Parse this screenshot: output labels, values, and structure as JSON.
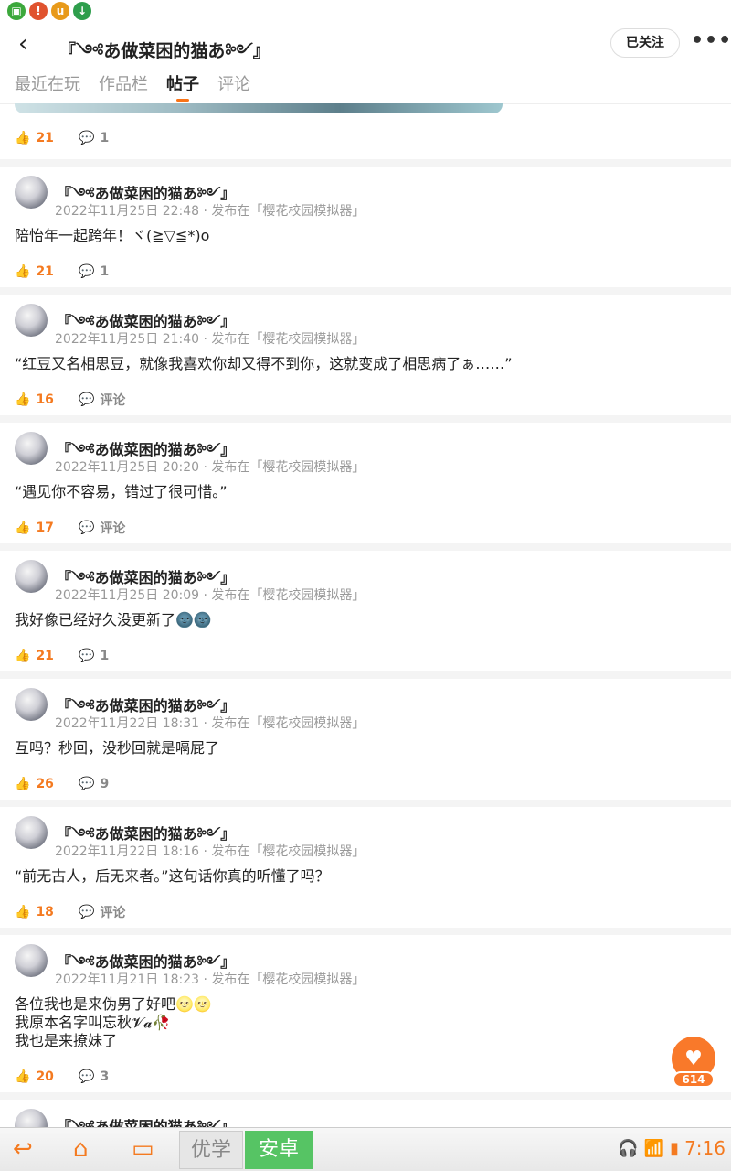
{
  "status_icons": [
    {
      "name": "gallery-icon",
      "glyph": "▣",
      "color": "#3ca83c"
    },
    {
      "name": "alert-icon",
      "glyph": "!",
      "color": "#e0532f"
    },
    {
      "name": "u-app-icon",
      "glyph": "u",
      "color": "#e89a1a"
    },
    {
      "name": "download-icon",
      "glyph": "↓",
      "color": "#2e9e4c"
    }
  ],
  "header": {
    "back_glyph": "‹",
    "title": "『༺あ做菜困的猫あ༻』",
    "follow_label": "已关注",
    "more_glyph": "•••"
  },
  "tabs": [
    "最近在玩",
    "作品栏",
    "帖子",
    "评论"
  ],
  "first_stats": {
    "likes": "21",
    "comments": "1"
  },
  "posts": [
    {
      "name": "『༺あ做菜困的猫あ༻』",
      "meta": "2022年11月25日 22:48 · 发布在「樱花校园模拟器」",
      "body": "陪怡年一起跨年！ヾ(≧▽≦*)o",
      "likes": "21",
      "comments": "1"
    },
    {
      "name": "『༺あ做菜困的猫あ༻』",
      "meta": "2022年11月25日 21:40 · 发布在「樱花校园模拟器」",
      "body": "“红豆又名相思豆，就像我喜欢你却又得不到你，这就变成了相思病了ぁ……”",
      "likes": "16",
      "comments": "评论"
    },
    {
      "name": "『༺あ做菜困的猫あ༻』",
      "meta": "2022年11月25日 20:20 · 发布在「樱花校园模拟器」",
      "body": "“遇见你不容易，错过了很可惜。”",
      "likes": "17",
      "comments": "评论"
    },
    {
      "name": "『༺あ做菜困的猫あ༻』",
      "meta": "2022年11月25日 20:09 · 发布在「樱花校园模拟器」",
      "body": "我好像已经好久没更新了🌚🌚",
      "likes": "21",
      "comments": "1"
    },
    {
      "name": "『༺あ做菜困的猫あ༻』",
      "meta": "2022年11月22日 18:31 · 发布在「樱花校园模拟器」",
      "body": "互吗？秒回，没秒回就是嗝屁了",
      "likes": "26",
      "comments": "9"
    },
    {
      "name": "『༺あ做菜困的猫あ༻』",
      "meta": "2022年11月22日 18:16 · 发布在「樱花校园模拟器」",
      "body": "“前无古人，后无来者。”这句话你真的听懂了吗？",
      "likes": "18",
      "comments": "评论"
    },
    {
      "name": "『༺あ做菜困的猫あ༻』",
      "meta": "2022年11月21日 18:23 · 发布在「樱花校园模拟器」",
      "body": "各位我也是来伪男了好吧🌝🌝\n我原本名字叫忘秋𝓥𝓪🥀\n我也是来撩妹了",
      "likes": "20",
      "comments": "3"
    },
    {
      "name": "『༺あ做菜困的猫あ༻』",
      "meta": "",
      "body": "",
      "likes": "",
      "comments": ""
    }
  ],
  "fab": {
    "glyph": "♥",
    "count": "614"
  },
  "navbar": {
    "back_glyph": "↩",
    "home_glyph": "⌂",
    "recents_glyph": "▭",
    "ime_left": "优学",
    "ime_right": "安卓",
    "time": "7:16",
    "accent": "#f47a20"
  }
}
